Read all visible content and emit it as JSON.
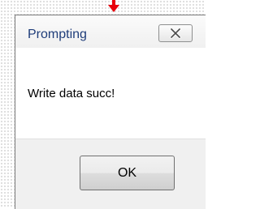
{
  "dialog": {
    "title": "Prompting",
    "message": "Write data succ!",
    "ok_label": "OK"
  },
  "icons": {
    "close": "close-icon",
    "annotation_arrow": "down-arrow-icon"
  },
  "colors": {
    "arrow": "#e8000b",
    "title_text": "#1f3d7a",
    "client_background": "#ffffff",
    "frame_background": "#f0f0f0"
  }
}
